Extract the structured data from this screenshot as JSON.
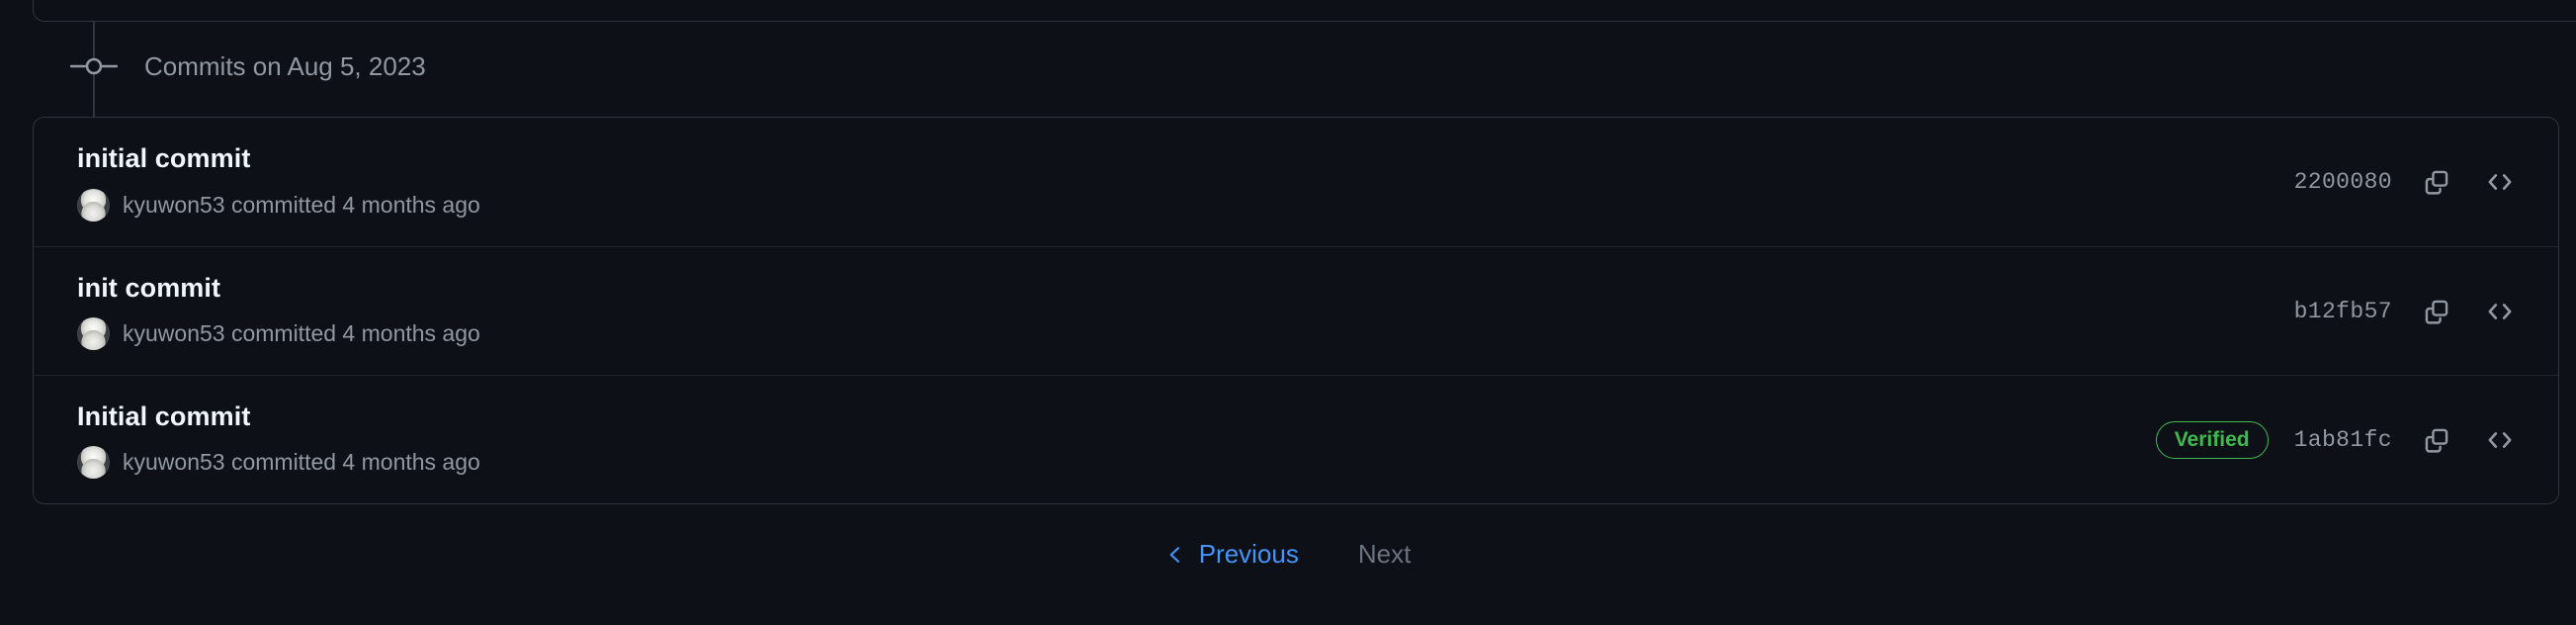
{
  "timeline": {
    "group_header": {
      "icon": "git-commit-icon",
      "label": "Commits on Aug 5, 2023"
    }
  },
  "commits": [
    {
      "title": "initial commit",
      "avatar": "user-avatar",
      "meta": "kyuwon53 committed 4 months ago",
      "author": "kyuwon53",
      "relative_time": "4 months ago",
      "verified": null,
      "sha": "2200080",
      "copy_icon": "copy-icon",
      "browse_icon": "code-icon"
    },
    {
      "title": "init commit",
      "avatar": "user-avatar",
      "meta": "kyuwon53 committed 4 months ago",
      "author": "kyuwon53",
      "relative_time": "4 months ago",
      "verified": null,
      "sha": "b12fb57",
      "copy_icon": "copy-icon",
      "browse_icon": "code-icon"
    },
    {
      "title": "Initial commit",
      "avatar": "user-avatar",
      "meta": "kyuwon53 committed 4 months ago",
      "author": "kyuwon53",
      "relative_time": "4 months ago",
      "verified": "Verified",
      "sha": "1ab81fc",
      "copy_icon": "copy-icon",
      "browse_icon": "code-icon"
    }
  ],
  "pagination": {
    "previous_label": "Previous",
    "next_label": "Next",
    "previous_icon": "chevron-left-icon",
    "previous_enabled": true,
    "next_enabled": false
  },
  "colors": {
    "background": "#0d1117",
    "border": "#30363d",
    "divider": "#21262d",
    "text_primary": "#f0f6fc",
    "text_muted": "#9198a1",
    "link": "#4493f8",
    "verified_green": "#3fb950",
    "disabled": "#6b7280"
  }
}
